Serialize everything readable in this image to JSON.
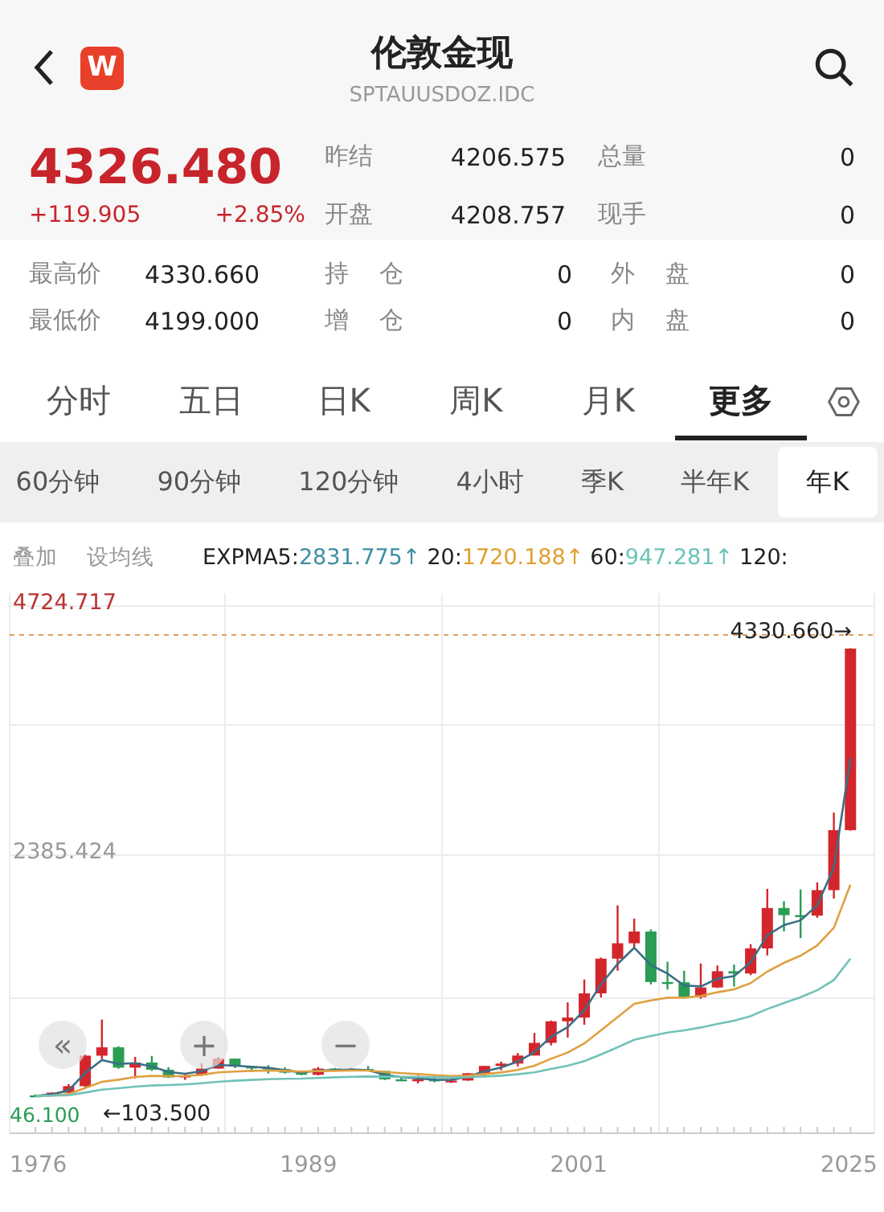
{
  "header": {
    "title": "伦敦金现",
    "subtitle": "SPTAUUSDOZ.IDC",
    "badge": "W"
  },
  "quote": {
    "price": "4326.480",
    "change": "+119.905",
    "change_pct": "+2.85%",
    "stats": [
      {
        "label": "昨结",
        "value": "4206.575",
        "label2": "总量",
        "value2": "0"
      },
      {
        "label": "开盘",
        "value": "4208.757",
        "label2": "现手",
        "value2": "0"
      }
    ],
    "details": [
      {
        "label": "最高价",
        "value": "4330.660",
        "label2": "持 仓",
        "value2": "0",
        "label3": "外 盘",
        "value3": "0"
      },
      {
        "label": "最低价",
        "value": "4199.000",
        "label2": "增 仓",
        "value2": "0",
        "label3": "内 盘",
        "value3": "0"
      }
    ]
  },
  "tabs": [
    {
      "label": "分时",
      "selected": false
    },
    {
      "label": "五日",
      "selected": false
    },
    {
      "label": "日K",
      "selected": false
    },
    {
      "label": "周K",
      "selected": false
    },
    {
      "label": "月K",
      "selected": false
    },
    {
      "label": "更多",
      "selected": true
    }
  ],
  "periods": [
    {
      "label": "60分钟",
      "selected": false
    },
    {
      "label": "90分钟",
      "selected": false
    },
    {
      "label": "120分钟",
      "selected": false
    },
    {
      "label": "4小时",
      "selected": false
    },
    {
      "label": "季K",
      "selected": false
    },
    {
      "label": "半年K",
      "selected": false
    },
    {
      "label": "年K",
      "selected": true
    }
  ],
  "indicator_bar": {
    "actions": [
      "叠加",
      "设均线"
    ],
    "lines": [
      {
        "label": "EXPMA5:",
        "value": "2831.775↑",
        "color": "#3d8fa3"
      },
      {
        "label": "20:",
        "value": "1720.188↑",
        "color": "#e0a030"
      },
      {
        "label": "60:",
        "value": "947.281↑",
        "color": "#6cc4b8"
      },
      {
        "label": "120:"
      }
    ]
  },
  "chart": {
    "y_max": "4724.717",
    "y_mid": "2385.424",
    "y_min": "46.100",
    "high_marker": "4330.660→",
    "low_marker": "←103.500",
    "x_labels": [
      "1976",
      "1989",
      "2001",
      "2025"
    ],
    "zoom_buttons": [
      "«",
      "+",
      "−"
    ]
  }
}
